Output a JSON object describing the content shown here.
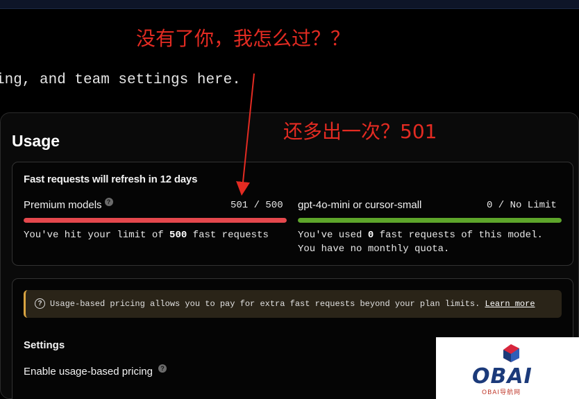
{
  "header": {
    "intro_text": "ing, and team settings here."
  },
  "annotations": {
    "top": "没有了你，我怎么过？？",
    "middle": "还多出一次？501",
    "color": "#e32b22"
  },
  "usage": {
    "title": "Usage",
    "refresh_text": "Fast requests will refresh in 12 days",
    "premium": {
      "label": "Premium models",
      "help_icon": "question-icon",
      "count_text": "501 / 500",
      "used": 501,
      "limit": 500,
      "bar_fraction": 1.0,
      "bar_color": "#e5484d",
      "message_pre": "You've hit your limit of ",
      "message_bold": "500",
      "message_post": " fast requests"
    },
    "small": {
      "label": "gpt-4o-mini or cursor-small",
      "count_text": "0 / No Limit",
      "bar_fraction": 1.0,
      "bar_color": "#5ea62b",
      "line1_pre": "You've used ",
      "line1_bold": "0",
      "line1_post": " fast requests of this model.",
      "line2": "You have no monthly quota."
    }
  },
  "pricing": {
    "alert_icon": "question-circle-icon",
    "alert_text": "Usage-based pricing allows you to pay for extra fast requests beyond your plan limits.",
    "learn_more": "Learn more",
    "settings_heading": "Settings",
    "enable_label": "Enable usage-based pricing"
  },
  "watermark": {
    "logo_text": "OBAI",
    "sub_text": "OBAI导航网"
  }
}
